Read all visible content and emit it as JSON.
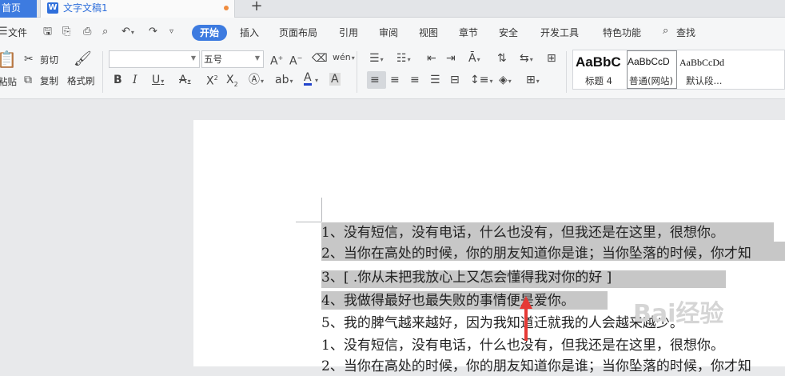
{
  "tabs": {
    "home": "首页",
    "doc_title": "文字文稿1",
    "new_tab": "+"
  },
  "menubar": {
    "file": "文件",
    "items": [
      "开始",
      "插入",
      "页面布局",
      "引用",
      "审阅",
      "视图",
      "章节",
      "安全",
      "开发工具",
      "特色功能"
    ],
    "search": "查找"
  },
  "ribbon": {
    "paste": "粘贴",
    "cut": "剪切",
    "copy": "复制",
    "format_painter": "格式刷",
    "font_name": "",
    "font_size": "五号",
    "styles": [
      {
        "sample": "AaBbC",
        "label": "标题 4"
      },
      {
        "sample": "AaBbCcD",
        "label": "普通(网站)"
      },
      {
        "sample": "AaBbCcDd",
        "label": "默认段..."
      }
    ]
  },
  "document": {
    "lines": [
      "1、没有短信，没有电话，什么也没有，但我还是在这里，很想你。",
      "2、当你在高处的时候，你的朋友知道你是谁；当你坠落的时候，你才知",
      "3、[        .你从未把我放心上又怎会懂得我对你的好    ]",
      "4、我做得最好也最失败的事情便是爱你。",
      "5、我的脾气越来越好，因为我知道迁就我的人会越来越少。",
      "1、没有短信，没有电话，什么也没有，但我还是在这里，很想你。",
      "2、当你在高处的时候，你的朋友知道你是谁；当你坠落的时候，你才知"
    ]
  },
  "watermark": "Bai经验",
  "colors": {
    "accent": "#3d7be0",
    "selection": "#c7c7c7",
    "arrow": "#e53935",
    "font_color_bar": "#2244cc"
  }
}
